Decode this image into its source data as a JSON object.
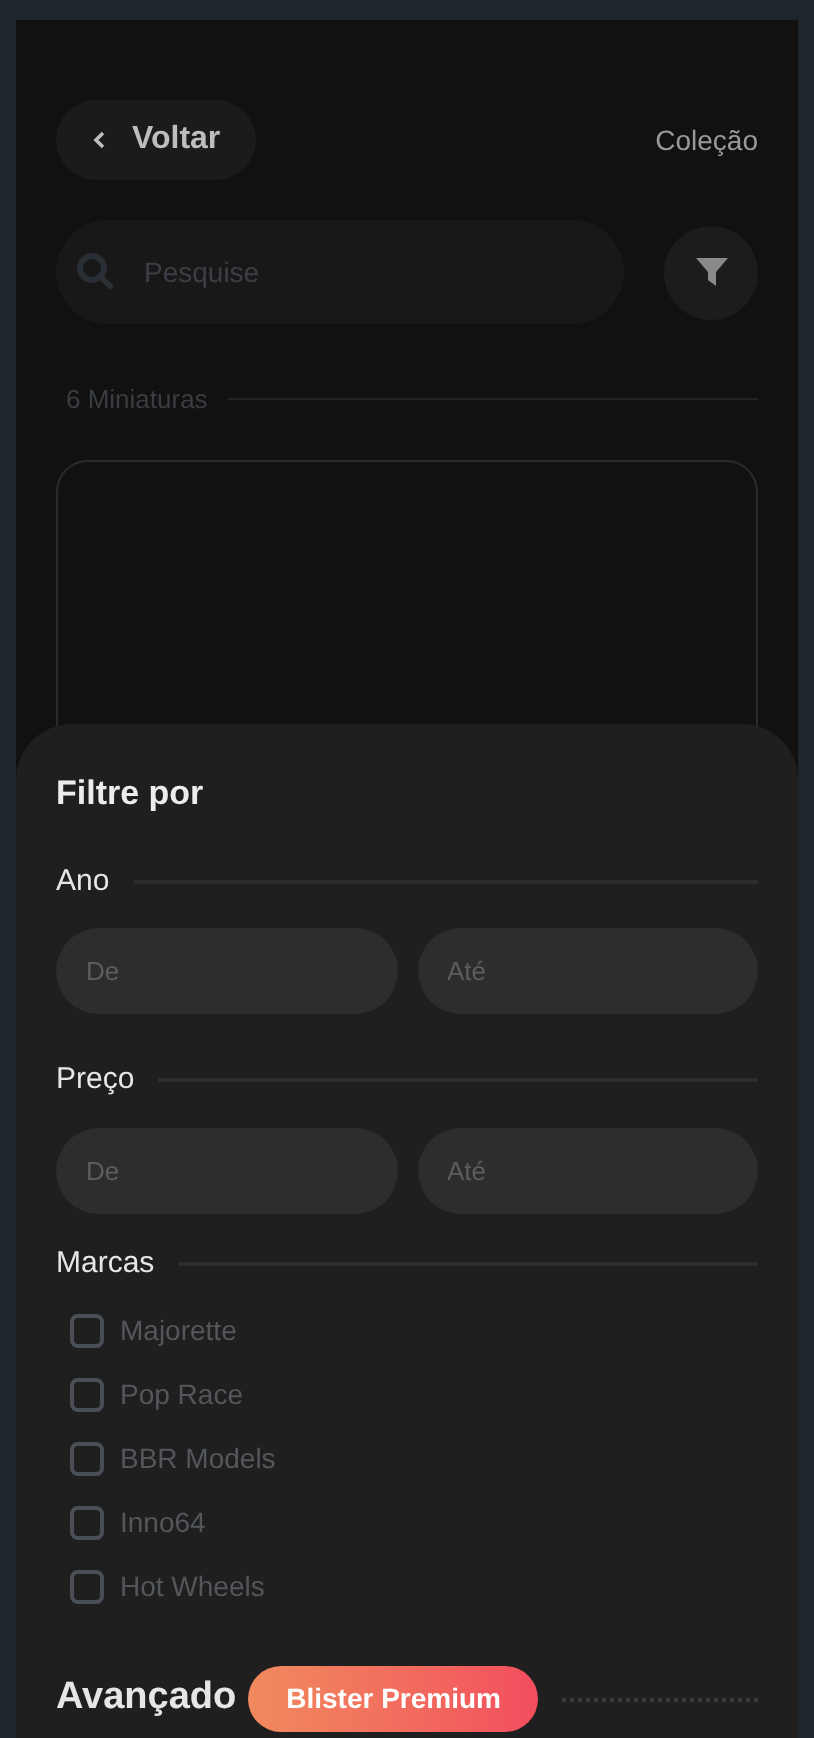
{
  "header": {
    "back_button": "Voltar",
    "title": "Coleção"
  },
  "search": {
    "placeholder": "Pesquise"
  },
  "count": "6 Miniaturas",
  "filter_sheet": {
    "title": "Filtre por",
    "ranges": [
      {
        "label": "Ano",
        "from_placeholder": "De",
        "to_placeholder": "Até"
      },
      {
        "label": "Preço",
        "from_placeholder": "De",
        "to_placeholder": "Até"
      }
    ],
    "brands_label": "Marcas",
    "brands": [
      {
        "label": "Majorette",
        "checked": false
      },
      {
        "label": "Pop Race",
        "checked": false
      },
      {
        "label": "BBR Models",
        "checked": false
      },
      {
        "label": "Inno64",
        "checked": false
      },
      {
        "label": "Hot Wheels",
        "checked": false
      }
    ],
    "advanced_label": "Avançado",
    "premium_badge": "Blister Premium"
  }
}
